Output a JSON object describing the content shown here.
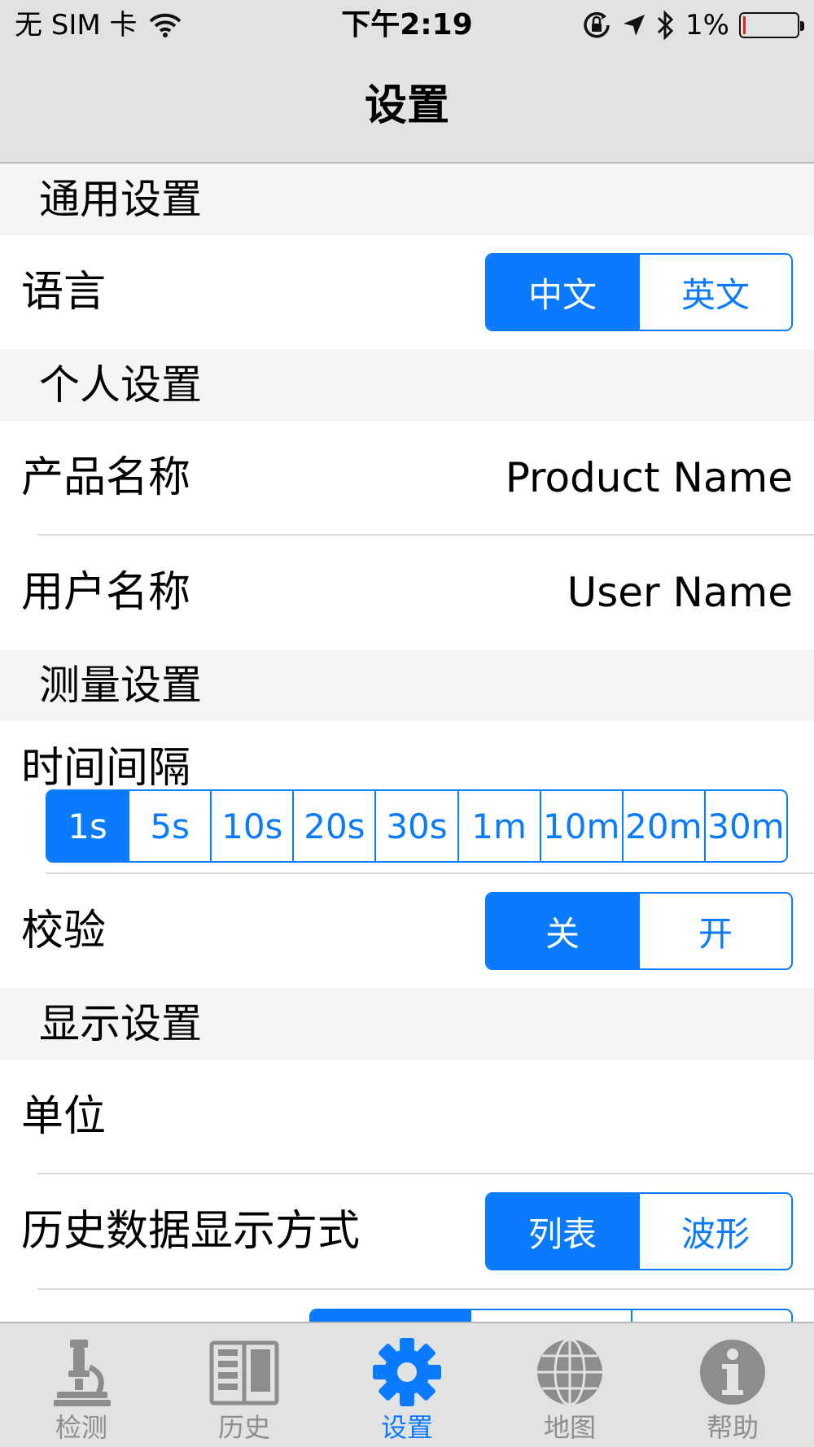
{
  "status_bar": {
    "carrier": "无 SIM 卡",
    "time": "下午2:19",
    "battery": "1%"
  },
  "nav": {
    "title": "设置"
  },
  "sections": {
    "general": {
      "title": "通用设置"
    },
    "personal": {
      "title": "个人设置"
    },
    "measure": {
      "title": "测量设置"
    },
    "display": {
      "title": "显示设置"
    }
  },
  "rows": {
    "language": {
      "label": "语言",
      "options": [
        "中文",
        "英文"
      ],
      "selected": 0
    },
    "product_name": {
      "label": "产品名称",
      "value": "Product Name"
    },
    "user_name": {
      "label": "用户名称",
      "value": "User Name"
    },
    "interval": {
      "label": "时间间隔",
      "options": [
        "1s",
        "5s",
        "10s",
        "20s",
        "30s",
        "1m",
        "10m",
        "20m",
        "30m"
      ],
      "selected": 0
    },
    "calibration": {
      "label": "校验",
      "options": [
        "关",
        "开"
      ],
      "selected": 0
    },
    "unit": {
      "label": "单位"
    },
    "history_mode": {
      "label": "历史数据显示方式",
      "options": [
        "列表",
        "波形"
      ],
      "selected": 0
    }
  },
  "tabs": [
    {
      "label": "检测",
      "icon": "microscope-icon"
    },
    {
      "label": "历史",
      "icon": "book-icon"
    },
    {
      "label": "设置",
      "icon": "gear-icon",
      "active": true
    },
    {
      "label": "地图",
      "icon": "globe-icon"
    },
    {
      "label": "帮助",
      "icon": "info-icon"
    }
  ],
  "colors": {
    "accent": "#0a7aff",
    "bar_bg": "#e2e2e2",
    "section_bg": "#f5f5f5",
    "tab_inactive": "#8d8d8d"
  }
}
